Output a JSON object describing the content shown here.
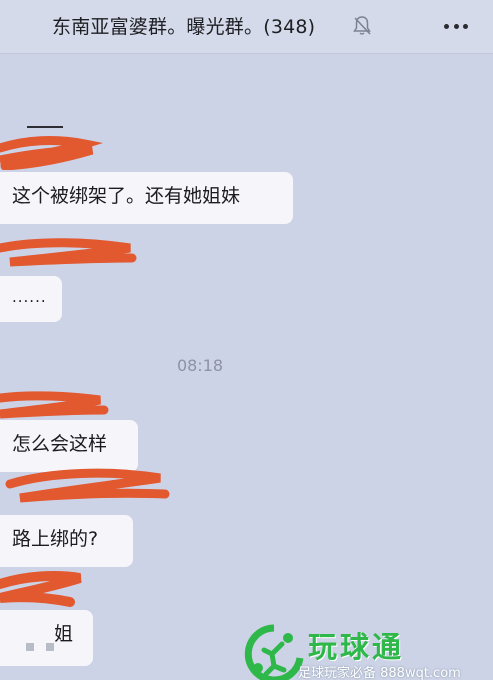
{
  "header": {
    "title": "东南亚富婆群。曝光群。(348)",
    "mute_icon": "bell-muted-icon",
    "more_icon": "more-dots-icon"
  },
  "messages": [
    {
      "text": "这个被绑架了。还有她姐妹"
    },
    {
      "text": "......"
    },
    {
      "text": "怎么会这样"
    },
    {
      "text": "路上绑的?"
    },
    {
      "text": "姐"
    }
  ],
  "timestamp": "08:18",
  "watermark": {
    "title": "玩球通",
    "subtitle": "足球玩家必备 888wqt.com"
  },
  "colors": {
    "background": "#cdd3e6",
    "bubble": "#f6f6fa",
    "redaction": "#e2582f",
    "watermark_green": "#2fb84a"
  }
}
